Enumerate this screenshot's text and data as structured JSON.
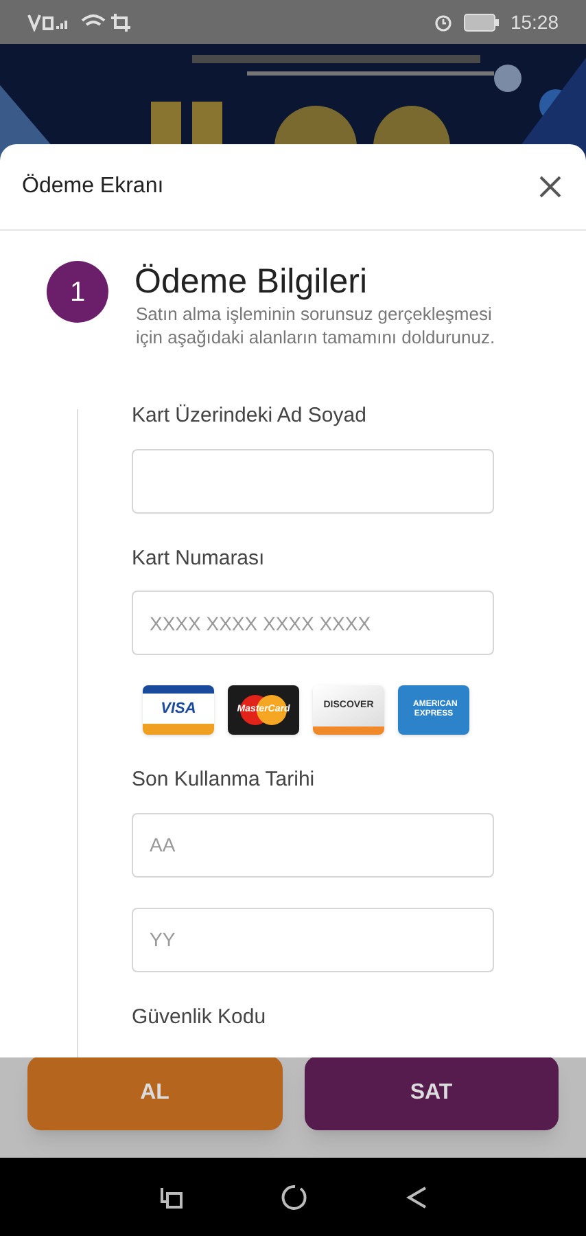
{
  "status_bar": {
    "time": "15:28"
  },
  "modal": {
    "title": "Ödeme Ekranı",
    "step": {
      "number": "1",
      "title": "Ödeme Bilgileri",
      "description": "Satın alma işleminin sorunsuz gerçekleşmesi için aşağıdaki alanların tamamını doldurunuz."
    },
    "fields": [
      {
        "kind": "input",
        "label": "Kart Üzerindeki Ad Soyad"
      },
      {
        "kind": "input",
        "label": "Kart Numarası",
        "placeholder": "XXXX XXXX XXXX XXXX"
      },
      {
        "kind": "cards",
        "cards": [
          {
            "kind": "visa",
            "label": "VISA"
          },
          {
            "kind": "mastercard",
            "label": "MasterCard"
          },
          {
            "kind": "discover",
            "label": "DISCOVER"
          },
          {
            "kind": "amex",
            "label": "AMERICAN EXPRESS"
          }
        ]
      },
      {
        "kind": "input",
        "label": "Son Kullanma Tarihi",
        "placeholder": "AA"
      },
      {
        "kind": "input",
        "placeholder": "YY"
      },
      {
        "kind": "label",
        "label": "Güvenlik Kodu"
      }
    ]
  },
  "buttons": [
    {
      "label": "AL",
      "color": "#b5651d"
    },
    {
      "label": "SAT",
      "color": "#561c4e"
    }
  ]
}
